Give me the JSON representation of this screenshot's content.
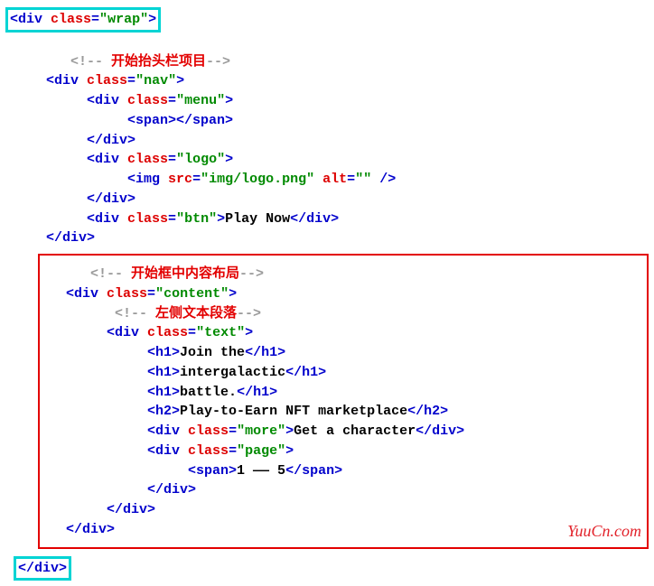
{
  "l1": {
    "open": "<div ",
    "attr": "class",
    "eq": "=",
    "q1": "\"",
    "val": "wrap",
    "q2": "\"",
    "close": ">"
  },
  "c1": {
    "open": "<!-- ",
    "text": "开始抬头栏项目",
    "close": "-->"
  },
  "l2": {
    "open": "<div ",
    "attr": "class",
    "eq": "=",
    "q1": "\"",
    "val": "nav",
    "q2": "\"",
    "close": ">"
  },
  "l3": {
    "open": "<div ",
    "attr": "class",
    "eq": "=",
    "q1": "\"",
    "val": "menu",
    "q2": "\"",
    "close": ">"
  },
  "l4": {
    "open": "<span></span>"
  },
  "l5": {
    "close": "</div>"
  },
  "l6": {
    "open": "<div ",
    "attr": "class",
    "eq": "=",
    "q1": "\"",
    "val": "logo",
    "q2": "\"",
    "close": ">"
  },
  "l7": {
    "open": "<img ",
    "a1": "src",
    "v1": "img/logo.png",
    "a2": "alt",
    "v2": "",
    "close": " />"
  },
  "l8": {
    "close": "</div>"
  },
  "l9": {
    "open": "<div ",
    "attr": "class",
    "eq": "=",
    "q1": "\"",
    "val": "btn",
    "q2": "\"",
    "close": ">",
    "text": "Play Now",
    "end": "</div>"
  },
  "l10": {
    "close": "</div>"
  },
  "c2": {
    "open": "<!-- ",
    "text": "开始框中内容布局",
    "close": "-->"
  },
  "l11": {
    "open": "<div ",
    "attr": "class",
    "eq": "=",
    "q1": "\"",
    "val": "content",
    "q2": "\"",
    "close": ">"
  },
  "c3": {
    "open": "<!-- ",
    "text": "左侧文本段落",
    "close": "-->"
  },
  "l12": {
    "open": "<div ",
    "attr": "class",
    "eq": "=",
    "q1": "\"",
    "val": "text",
    "q2": "\"",
    "close": ">"
  },
  "l13": {
    "open": "<h1>",
    "text": "Join the",
    "end": "</h1>"
  },
  "l14": {
    "open": "<h1>",
    "text": "intergalactic",
    "end": "</h1>"
  },
  "l15": {
    "open": "<h1>",
    "text": "battle.",
    "end": "</h1>"
  },
  "l16": {
    "open": "<h2>",
    "text": "Play-to-Earn NFT marketplace",
    "end": "</h2>"
  },
  "l17": {
    "open": "<div ",
    "attr": "class",
    "eq": "=",
    "q1": "\"",
    "val": "more",
    "q2": "\"",
    "close": ">",
    "text": "Get a character",
    "end": "</div>"
  },
  "l18": {
    "open": "<div ",
    "attr": "class",
    "eq": "=",
    "q1": "\"",
    "val": "page",
    "q2": "\"",
    "close": ">"
  },
  "l19": {
    "open": "<span>",
    "text": "1 —— 5",
    "end": "</span>"
  },
  "l20": {
    "close": "</div>"
  },
  "l21": {
    "close": "</div>"
  },
  "l22": {
    "close": "</div>"
  },
  "l23": {
    "close": "</div>"
  },
  "watermark": "YuuCn.com"
}
